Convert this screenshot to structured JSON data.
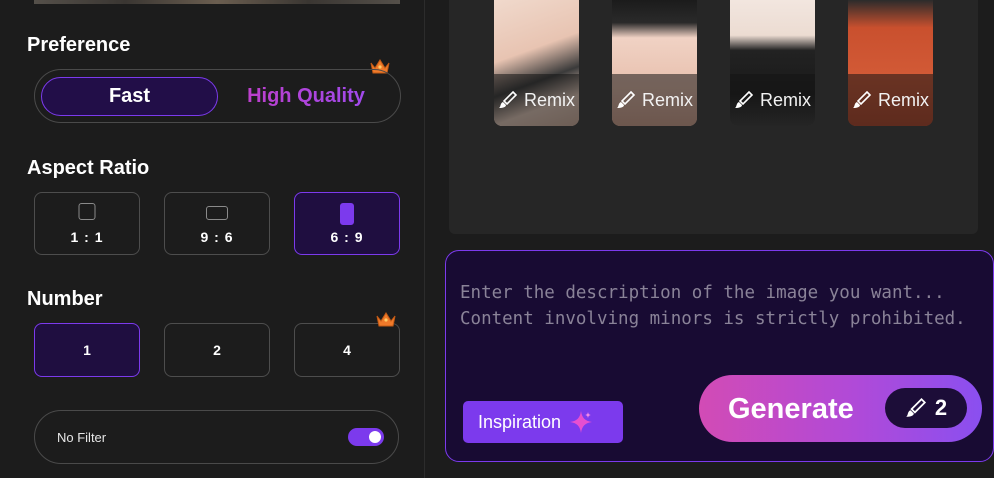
{
  "preference": {
    "title": "Preference",
    "options": [
      "Fast",
      "High Quality"
    ],
    "selected": "Fast"
  },
  "aspect_ratio": {
    "title": "Aspect Ratio",
    "options": [
      "1 : 1",
      "9 : 6",
      "6 : 9"
    ],
    "selected": "6 : 9"
  },
  "number": {
    "title": "Number",
    "options": [
      "1",
      "2",
      "4"
    ],
    "selected": "1"
  },
  "filter": {
    "label": "No Filter",
    "enabled": true
  },
  "gallery": {
    "cards": [
      {
        "remix_label": "Remix"
      },
      {
        "remix_label": "Remix"
      },
      {
        "remix_label": "Remix"
      },
      {
        "remix_label": "Remix"
      }
    ]
  },
  "prompt": {
    "placeholder": "Enter the description of the image you want... Content involving minors is strictly prohibited.",
    "inspiration_label": "Inspiration"
  },
  "generate": {
    "label": "Generate",
    "cost": "2"
  },
  "colors": {
    "accent": "#7c3aed",
    "background": "#1c1c1c",
    "premium_gradient_start": "#c03ec8",
    "premium_gradient_end": "#9d4bf0",
    "crown": "#f07a2a"
  }
}
